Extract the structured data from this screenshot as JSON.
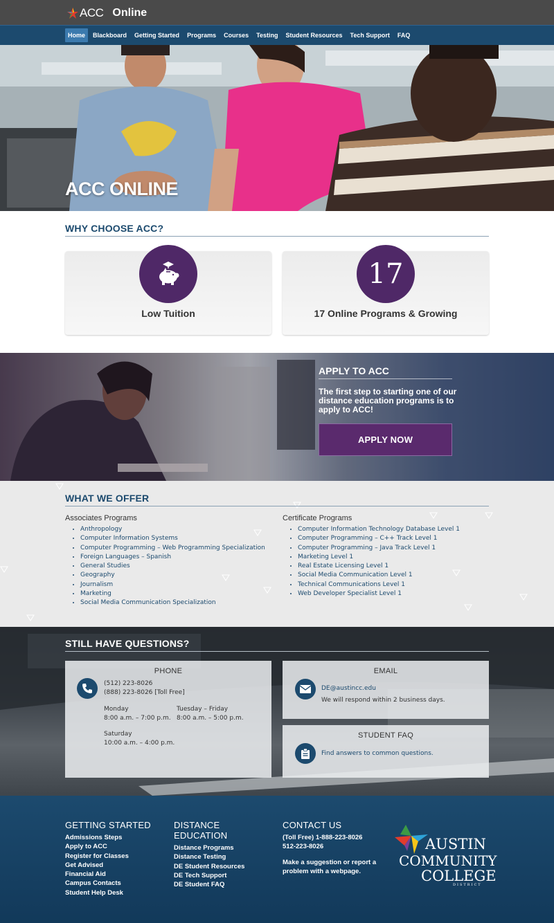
{
  "brand": {
    "acc": "ACC",
    "online": "Online"
  },
  "nav": {
    "items": [
      "Home",
      "Blackboard",
      "Getting Started",
      "Programs",
      "Courses",
      "Testing",
      "Student Resources",
      "Tech Support",
      "FAQ"
    ],
    "active": "Home"
  },
  "hero": {
    "title": "ACC ONLINE"
  },
  "why": {
    "title": "WHY CHOOSE ACC?",
    "cards": [
      {
        "label": "Low Tuition",
        "icon": "piggy-bank-icon"
      },
      {
        "label": "17 Online Programs & Growing",
        "number": "17"
      }
    ]
  },
  "apply": {
    "title": "APPLY TO ACC",
    "text": "The first step to starting one of our distance education programs is to apply to ACC!",
    "button": "APPLY NOW"
  },
  "offer": {
    "title": "WHAT WE OFFER",
    "associates": {
      "title": "Associates Programs",
      "items": [
        "Anthropology",
        "Computer Information Systems",
        "Computer Programming – Web Programming Specialization",
        "Foreign Languages – Spanish",
        "General Studies",
        "Geography",
        "Journalism",
        "Marketing",
        "Social Media Communication Specialization"
      ]
    },
    "certificates": {
      "title": "Certificate Programs",
      "items": [
        "Computer Information Technology Database Level 1",
        "Computer Programming – C++ Track Level 1",
        "Computer Programming – Java Track Level 1",
        "Marketing Level 1",
        "Real Estate Licensing Level 1",
        "Social Media Communication Level 1",
        "Technical Communications Level 1",
        "Web Developer Specialist Level 1"
      ]
    }
  },
  "questions": {
    "title": "STILL HAVE QUESTIONS?",
    "phone": {
      "title": "PHONE",
      "line1": "(512) 223-8026",
      "line2": "(888) 223-8026 [Toll Free]",
      "mon_label": "Monday",
      "mon_hours": "8:00 a.m. – 7:00 p.m.",
      "tue_label": "Tuesday – Friday",
      "tue_hours": "8:00 a.m. – 5:00 p.m.",
      "sat_label": "Saturday",
      "sat_hours": "10:00 a.m. – 4:00 p.m."
    },
    "email": {
      "title": "EMAIL",
      "address": "DE@austincc.edu",
      "note": "We will respond within 2 business days."
    },
    "faq": {
      "title": "STUDENT FAQ",
      "link": "Find answers to common questions."
    }
  },
  "footer": {
    "getting_started": {
      "title": "GETTING STARTED",
      "links": [
        "Admissions Steps",
        "Apply to ACC",
        "Register for Classes",
        "Get Advised",
        "Financial Aid",
        "Campus Contacts",
        "Student Help Desk"
      ]
    },
    "distance": {
      "title_line1": "DISTANCE",
      "title_line2": "EDUCATION",
      "links": [
        "Distance Programs",
        "Distance Testing",
        "DE Student Resources",
        "DE Tech Support",
        "DE Student FAQ"
      ]
    },
    "contact": {
      "title": "CONTACT US",
      "tollfree": "(Toll Free) 1-888-223-8026",
      "local": "512-223-8026",
      "suggestion": "Make a suggestion or report a problem with a webpage."
    },
    "logo": {
      "line1": "AUSTIN",
      "line2": "COMMUNITY",
      "line3": "COLLEGE",
      "line4": "DISTRICT"
    }
  },
  "colors": {
    "navy": "#1c4a6e",
    "purple": "#4f2867",
    "topbar": "#4a4a4a"
  }
}
